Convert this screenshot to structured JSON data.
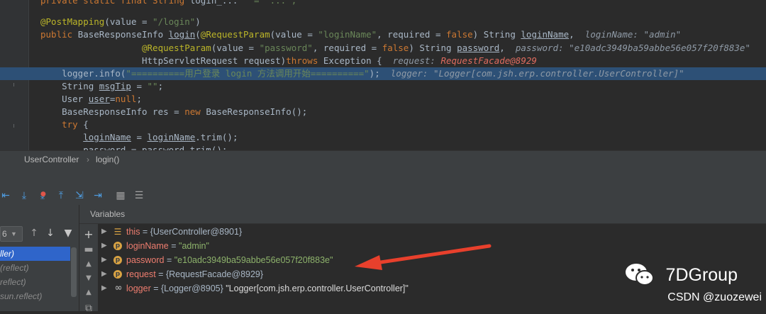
{
  "editor": {
    "lines": [
      {
        "parts": [
          {
            "t": "private static final String ",
            "c": "kw"
          },
          {
            "t": "login_...   ",
            "c": ""
          },
          {
            "t": "= \"...\";",
            "c": "str"
          }
        ]
      },
      {
        "parts": [
          {
            "t": "",
            "c": ""
          }
        ]
      },
      {
        "parts": [
          {
            "t": "@PostMapping",
            "c": "ann"
          },
          {
            "t": "(value = ",
            "c": ""
          },
          {
            "t": "\"/login\"",
            "c": "str"
          },
          {
            "t": ")",
            "c": ""
          }
        ]
      },
      {
        "parts": [
          {
            "t": "public ",
            "c": "kw"
          },
          {
            "t": "BaseResponseInfo ",
            "c": ""
          },
          {
            "t": "login",
            "c": "ul"
          },
          {
            "t": "(",
            "c": ""
          },
          {
            "t": "@RequestParam",
            "c": "ann"
          },
          {
            "t": "(value = ",
            "c": ""
          },
          {
            "t": "\"loginName\"",
            "c": "str"
          },
          {
            "t": ", required = ",
            "c": ""
          },
          {
            "t": "false",
            "c": "kw"
          },
          {
            "t": ") String ",
            "c": ""
          },
          {
            "t": "loginName",
            "c": "ul"
          },
          {
            "t": ",  ",
            "c": ""
          },
          {
            "t": "loginName: \"admin\"",
            "c": "hint"
          }
        ]
      },
      {
        "parts": [
          {
            "t": "                   ",
            "c": ""
          },
          {
            "t": "@RequestParam",
            "c": "ann"
          },
          {
            "t": "(value = ",
            "c": ""
          },
          {
            "t": "\"password\"",
            "c": "str"
          },
          {
            "t": ", required = ",
            "c": ""
          },
          {
            "t": "false",
            "c": "kw"
          },
          {
            "t": ") String ",
            "c": ""
          },
          {
            "t": "password",
            "c": "ul"
          },
          {
            "t": ",  ",
            "c": ""
          },
          {
            "t": "password: \"e10adc3949ba59abbe56e057f20f883e\"",
            "c": "hint"
          }
        ]
      },
      {
        "parts": [
          {
            "t": "                   HttpServletRequest request)",
            "c": ""
          },
          {
            "t": "throws ",
            "c": "kw"
          },
          {
            "t": "Exception {  ",
            "c": ""
          },
          {
            "t": "request: ",
            "c": "hint"
          },
          {
            "t": "RequestFacade@8929",
            "c": "hint-r"
          }
        ]
      },
      {
        "parts": [
          {
            "t": "    logger.info(",
            "c": ""
          },
          {
            "t": "\"==========用户登录 login 方法调用开始==========\"",
            "c": "str"
          },
          {
            "t": ");  ",
            "c": ""
          },
          {
            "t": "logger: \"Logger[com.jsh.erp.controller.UserController]\"",
            "c": "hint"
          }
        ],
        "highlight": true
      },
      {
        "parts": [
          {
            "t": "    String ",
            "c": ""
          },
          {
            "t": "msgTip",
            "c": "ul"
          },
          {
            "t": " = ",
            "c": ""
          },
          {
            "t": "\"\"",
            "c": "str"
          },
          {
            "t": ";",
            "c": ""
          }
        ]
      },
      {
        "parts": [
          {
            "t": "    User ",
            "c": ""
          },
          {
            "t": "user",
            "c": "ul"
          },
          {
            "t": "=",
            "c": ""
          },
          {
            "t": "null",
            "c": "kw"
          },
          {
            "t": ";",
            "c": ""
          }
        ]
      },
      {
        "parts": [
          {
            "t": "    BaseResponseInfo res = ",
            "c": ""
          },
          {
            "t": "new ",
            "c": "kw"
          },
          {
            "t": "BaseResponseInfo();",
            "c": ""
          }
        ]
      },
      {
        "parts": [
          {
            "t": "    ",
            "c": ""
          },
          {
            "t": "try ",
            "c": "kw"
          },
          {
            "t": "{",
            "c": ""
          }
        ]
      },
      {
        "parts": [
          {
            "t": "        ",
            "c": ""
          },
          {
            "t": "loginName",
            "c": "ul"
          },
          {
            "t": " = ",
            "c": ""
          },
          {
            "t": "loginName",
            "c": "ul"
          },
          {
            "t": ".trim();",
            "c": ""
          }
        ]
      },
      {
        "parts": [
          {
            "t": "        password = password.trim();",
            "c": ""
          }
        ]
      }
    ]
  },
  "breadcrumb": {
    "class_name": "UserController",
    "method": "login()"
  },
  "frames": {
    "thread_label": "6",
    "items": [
      {
        "label": "ller)",
        "selected": true
      },
      {
        "label": "(reflect)",
        "selected": false
      },
      {
        "label": "reflect)",
        "selected": false
      },
      {
        "label": "sun.reflect)",
        "selected": false
      }
    ]
  },
  "variables": {
    "header": "Variables",
    "rows": [
      {
        "icon": "lines",
        "name": "this",
        "eq": " = ",
        "ref": "{UserController@8901}",
        "value": ""
      },
      {
        "icon": "p",
        "name": "loginName",
        "eq": " = ",
        "ref": "",
        "value": "\"admin\""
      },
      {
        "icon": "p",
        "name": "password",
        "eq": " = ",
        "ref": "",
        "value": "\"e10adc3949ba59abbe56e057f20f883e\""
      },
      {
        "icon": "p",
        "name": "request",
        "eq": " = ",
        "ref": "{RequestFacade@8929}",
        "value": ""
      },
      {
        "icon": "inf",
        "name": "logger",
        "eq": " = ",
        "ref": "{Logger@8905} ",
        "value": "\"Logger[com.jsh.erp.controller.UserController]\""
      }
    ]
  },
  "watermark": {
    "brand": "7DGroup",
    "credit": "CSDN @zuozewei"
  },
  "colors": {
    "accent": "#2f65ca",
    "arrow": "#e8402c",
    "highlight_line": "#2d5076"
  }
}
